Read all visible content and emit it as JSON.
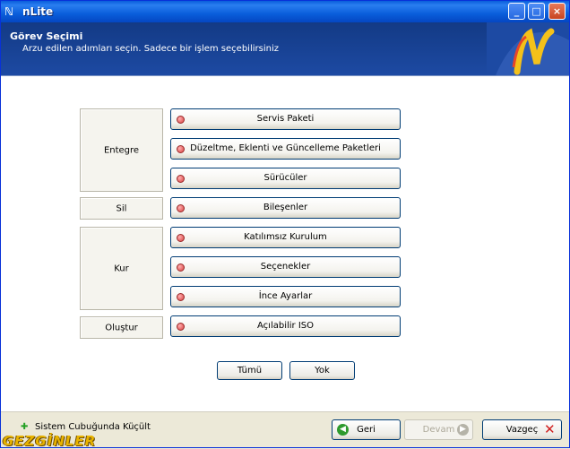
{
  "window": {
    "title": "nLite",
    "app_icon": "nlite-icon",
    "minimize": "_",
    "maximize": "□",
    "close": "×"
  },
  "header": {
    "title": "Görev Seçimi",
    "subtitle": "Arzu edilen adımları seçin. Sadece bir işlem seçebilirsiniz"
  },
  "groups": [
    {
      "label": "Entegre"
    },
    {
      "label": "Sil"
    },
    {
      "label": "Kur"
    },
    {
      "label": "Oluştur"
    }
  ],
  "tasks": [
    {
      "label": "Servis Paketi"
    },
    {
      "label": "Düzeltme, Eklenti ve Güncelleme Paketleri"
    },
    {
      "label": "Sürücüler"
    },
    {
      "label": "Bileşenler"
    },
    {
      "label": "Katılımsız Kurulum"
    },
    {
      "label": "Seçenekler"
    },
    {
      "label": "İnce Ayarlar"
    },
    {
      "label": "Açılabilir ISO"
    }
  ],
  "select_all": "Tümü",
  "select_none": "Yok",
  "footer": {
    "tray_checkbox": "Sistem Cubuğunda Küçült",
    "back": "Geri",
    "next": "Devam",
    "cancel": "Vazgeç"
  },
  "watermark": "GEZGİNLER",
  "colors": {
    "header_bg": "#133a85",
    "titlebar": "#0a5edb",
    "task_dot": "#d84040"
  }
}
